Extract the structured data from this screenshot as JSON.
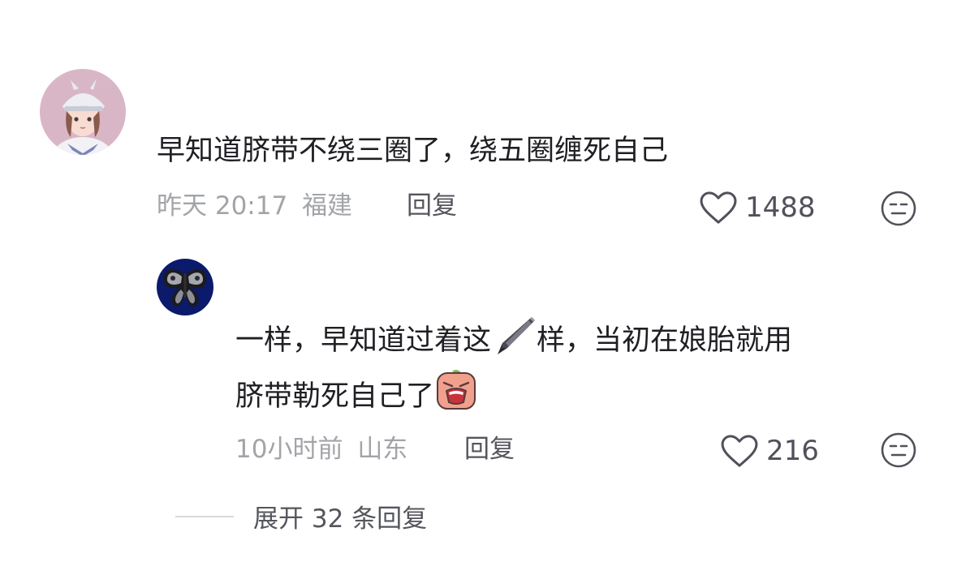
{
  "comments": [
    {
      "avatar": "girl-with-cap-avatar",
      "text": "早知道脐带不绕三圈了，绕五圈缠死自己",
      "time": "昨天 20:17",
      "location": "福建",
      "reply_label": "回复",
      "likes": "1488"
    }
  ],
  "reply": {
    "avatar": "butterfly-avatar",
    "line1_a": "一样，早知道过着这",
    "line1_emoji": "pen-icon",
    "line1_b": "样，当初在娘胎就用",
    "line2": "脐带勒死自己了",
    "line2_emoji": "crying-face-emoji",
    "time": "10小时前",
    "location": "山东",
    "reply_label": "回复",
    "likes": "216"
  },
  "expand": {
    "label": "展开 32 条回复"
  },
  "colors": {
    "text": "#1f1f24",
    "meta": "#a3a4a8",
    "action": "#55565c"
  }
}
